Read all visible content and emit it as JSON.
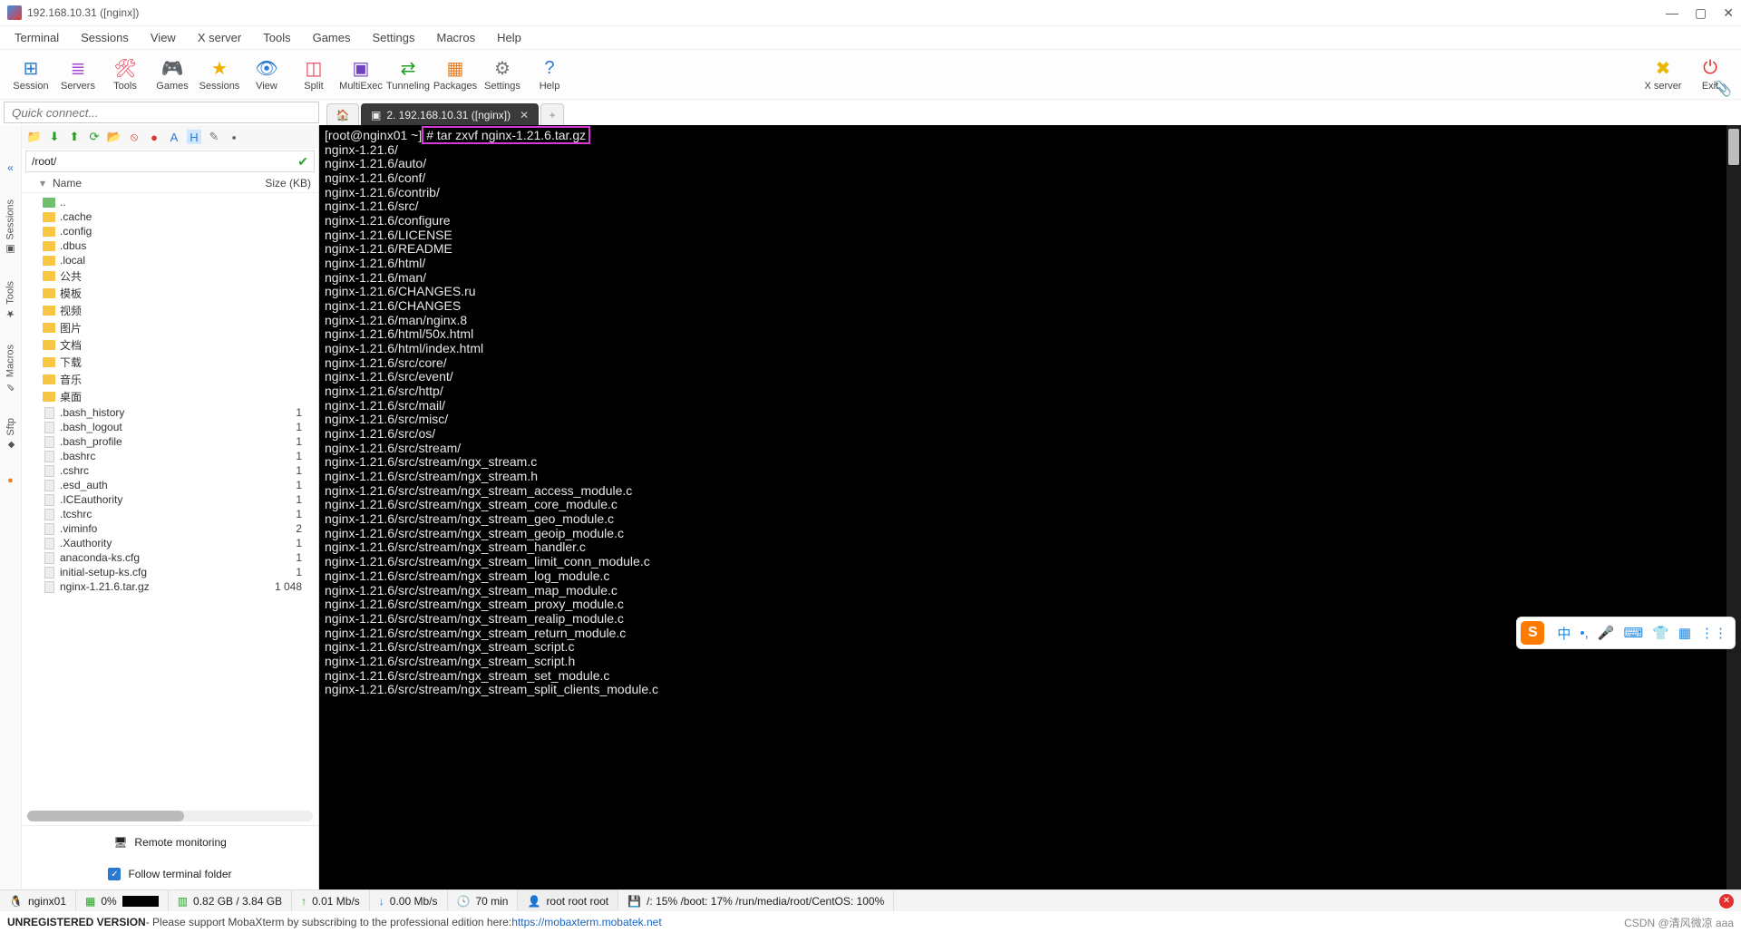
{
  "window": {
    "title": "192.168.10.31 ([nginx])"
  },
  "menu": [
    "Terminal",
    "Sessions",
    "View",
    "X server",
    "Tools",
    "Games",
    "Settings",
    "Macros",
    "Help"
  ],
  "toolbar": {
    "left": [
      {
        "label": "Session",
        "icon": "⊞",
        "color": "#2a7ad1"
      },
      {
        "label": "Servers",
        "icon": "≣",
        "color": "#a54ad6"
      },
      {
        "label": "Tools",
        "icon": "🛠",
        "color": "#e6455b"
      },
      {
        "label": "Games",
        "icon": "🎮",
        "color": "#f2b100"
      },
      {
        "label": "Sessions",
        "icon": "★",
        "color": "#f2b100"
      },
      {
        "label": "View",
        "icon": "👁",
        "color": "#2a7ad1"
      },
      {
        "label": "Split",
        "icon": "◫",
        "color": "#e6455b"
      },
      {
        "label": "MultiExec",
        "icon": "▣",
        "color": "#6f42c1"
      },
      {
        "label": "Tunneling",
        "icon": "⇄",
        "color": "#20a020"
      },
      {
        "label": "Packages",
        "icon": "▦",
        "color": "#e67e22"
      },
      {
        "label": "Settings",
        "icon": "⚙",
        "color": "#777"
      },
      {
        "label": "Help",
        "icon": "?",
        "color": "#2a7ad1"
      }
    ],
    "right": [
      {
        "label": "X server",
        "icon": "✖",
        "color": "#e6b800"
      },
      {
        "label": "Exit",
        "icon": "⏻",
        "color": "#e03030"
      }
    ]
  },
  "quick": {
    "placeholder": "Quick connect..."
  },
  "tabs": {
    "active": "2. 192.168.10.31 ([nginx])"
  },
  "leftstrip": [
    "Sessions",
    "Tools",
    "Macros",
    "Sftp"
  ],
  "sidebar": {
    "path": "/root/",
    "col_name": "Name",
    "col_size": "Size (KB)",
    "items": [
      {
        "name": "..",
        "type": "up"
      },
      {
        "name": ".cache",
        "type": "folder"
      },
      {
        "name": ".config",
        "type": "folder"
      },
      {
        "name": ".dbus",
        "type": "folder"
      },
      {
        "name": ".local",
        "type": "folder"
      },
      {
        "name": "公共",
        "type": "folder"
      },
      {
        "name": "模板",
        "type": "folder"
      },
      {
        "name": "视频",
        "type": "folder"
      },
      {
        "name": "图片",
        "type": "folder"
      },
      {
        "name": "文档",
        "type": "folder"
      },
      {
        "name": "下载",
        "type": "folder"
      },
      {
        "name": "音乐",
        "type": "folder"
      },
      {
        "name": "桌面",
        "type": "folder"
      },
      {
        "name": ".bash_history",
        "type": "file",
        "size": "1"
      },
      {
        "name": ".bash_logout",
        "type": "file",
        "size": "1"
      },
      {
        "name": ".bash_profile",
        "type": "file",
        "size": "1"
      },
      {
        "name": ".bashrc",
        "type": "file",
        "size": "1"
      },
      {
        "name": ".cshrc",
        "type": "file",
        "size": "1"
      },
      {
        "name": ".esd_auth",
        "type": "file",
        "size": "1"
      },
      {
        "name": ".ICEauthority",
        "type": "file",
        "size": "1"
      },
      {
        "name": ".tcshrc",
        "type": "file",
        "size": "1"
      },
      {
        "name": ".viminfo",
        "type": "file",
        "size": "2"
      },
      {
        "name": ".Xauthority",
        "type": "file",
        "size": "1"
      },
      {
        "name": "anaconda-ks.cfg",
        "type": "file",
        "size": "1"
      },
      {
        "name": "initial-setup-ks.cfg",
        "type": "file",
        "size": "1"
      },
      {
        "name": "nginx-1.21.6.tar.gz",
        "type": "file",
        "size": "1 048"
      }
    ],
    "remote_monitoring": "Remote monitoring",
    "follow_terminal": "Follow terminal folder"
  },
  "terminal": {
    "prompt": "[root@nginx01 ~]",
    "command": "# tar zxvf nginx-1.21.6.tar.gz",
    "lines": [
      "nginx-1.21.6/",
      "nginx-1.21.6/auto/",
      "nginx-1.21.6/conf/",
      "nginx-1.21.6/contrib/",
      "nginx-1.21.6/src/",
      "nginx-1.21.6/configure",
      "nginx-1.21.6/LICENSE",
      "nginx-1.21.6/README",
      "nginx-1.21.6/html/",
      "nginx-1.21.6/man/",
      "nginx-1.21.6/CHANGES.ru",
      "nginx-1.21.6/CHANGES",
      "nginx-1.21.6/man/nginx.8",
      "nginx-1.21.6/html/50x.html",
      "nginx-1.21.6/html/index.html",
      "nginx-1.21.6/src/core/",
      "nginx-1.21.6/src/event/",
      "nginx-1.21.6/src/http/",
      "nginx-1.21.6/src/mail/",
      "nginx-1.21.6/src/misc/",
      "nginx-1.21.6/src/os/",
      "nginx-1.21.6/src/stream/",
      "nginx-1.21.6/src/stream/ngx_stream.c",
      "nginx-1.21.6/src/stream/ngx_stream.h",
      "nginx-1.21.6/src/stream/ngx_stream_access_module.c",
      "nginx-1.21.6/src/stream/ngx_stream_core_module.c",
      "nginx-1.21.6/src/stream/ngx_stream_geo_module.c",
      "nginx-1.21.6/src/stream/ngx_stream_geoip_module.c",
      "nginx-1.21.6/src/stream/ngx_stream_handler.c",
      "nginx-1.21.6/src/stream/ngx_stream_limit_conn_module.c",
      "nginx-1.21.6/src/stream/ngx_stream_log_module.c",
      "nginx-1.21.6/src/stream/ngx_stream_map_module.c",
      "nginx-1.21.6/src/stream/ngx_stream_proxy_module.c",
      "nginx-1.21.6/src/stream/ngx_stream_realip_module.c",
      "nginx-1.21.6/src/stream/ngx_stream_return_module.c",
      "nginx-1.21.6/src/stream/ngx_stream_script.c",
      "nginx-1.21.6/src/stream/ngx_stream_script.h",
      "nginx-1.21.6/src/stream/ngx_stream_set_module.c",
      "nginx-1.21.6/src/stream/ngx_stream_split_clients_module.c"
    ]
  },
  "status": {
    "host": "nginx01",
    "cpu": "0%",
    "ram": "0.82 GB / 3.84 GB",
    "up": "0.01 Mb/s",
    "down": "0.00 Mb/s",
    "uptime": "70 min",
    "user": "root  root  root",
    "disks": "/: 15%   /boot: 17%   /run/media/root/CentOS: 100%"
  },
  "bottom": {
    "unreg": "UNREGISTERED VERSION",
    "msg": "  -  Please support MobaXterm by subscribing to the professional edition here:  ",
    "url": "https://mobaxterm.mobatek.net",
    "credit": "CSDN @清风微凉 aaa"
  },
  "ime": {
    "label": "中"
  }
}
